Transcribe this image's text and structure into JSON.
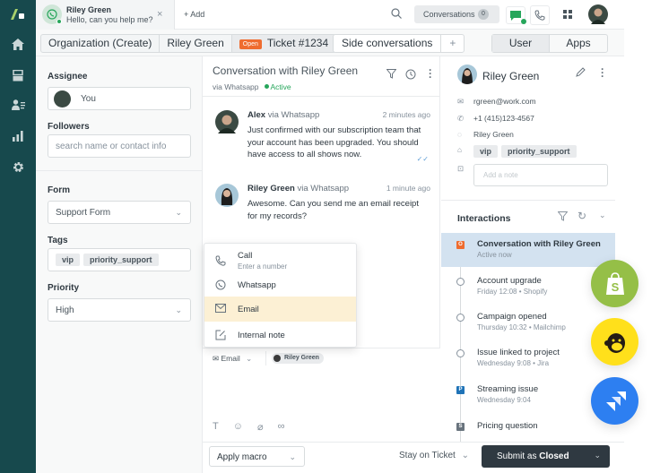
{
  "nav": {
    "items": [
      "home-icon",
      "tickets-icon",
      "customers-icon",
      "reporting-icon",
      "settings-icon"
    ]
  },
  "topbar": {
    "tab": {
      "name": "Riley Green",
      "message": "Hello, can you help me?",
      "close": "×",
      "channel_icon": "whatsapp-icon"
    },
    "add_label": "+ Add",
    "conversations_label": "Conversations",
    "conversations_count": "0"
  },
  "breadcrumbs": {
    "organization": "Organization (Create)",
    "user": "Riley Green",
    "status_badge": "Open",
    "ticket": "Ticket #1234",
    "side_conversations": "Side conversations",
    "add": "+",
    "user_tab": "User",
    "apps_tab": "Apps"
  },
  "left": {
    "assignee_label": "Assignee",
    "assignee_value": "You",
    "followers_label": "Followers",
    "followers_placeholder": "search name or contact info",
    "form_label": "Form",
    "form_value": "Support Form",
    "tags_label": "Tags",
    "tags": [
      "vip",
      "priority_support"
    ],
    "priority_label": "Priority",
    "priority_value": "High"
  },
  "conversation": {
    "title": "Conversation with Riley Green",
    "channel": "via Whatsapp",
    "status": "Active",
    "messages": [
      {
        "author": "Alex",
        "via": "via Whatsapp",
        "time": "2 minutes ago",
        "text": "Just confirmed with our subscription team that your account has been upgraded. You should have access to all shows now."
      },
      {
        "author": "Riley Green",
        "via": "via Whatsapp",
        "time": "1 minute ago",
        "text": "Awesome. Can you send me an email receipt for my records?"
      }
    ]
  },
  "channel_menu": {
    "items": [
      {
        "label": "Call",
        "sub": "Enter a number",
        "icon": "phone-icon"
      },
      {
        "label": "Whatsapp",
        "icon": "whatsapp-icon"
      },
      {
        "label": "Email",
        "icon": "email-icon",
        "selected": true
      },
      {
        "label": "Internal note",
        "icon": "note-icon"
      }
    ]
  },
  "composer": {
    "channel": "Email",
    "recipient": "Riley Green"
  },
  "footer": {
    "macro": "Apply macro",
    "stay": "Stay on Ticket",
    "submit_prefix": "Submit as ",
    "submit_status": "Closed"
  },
  "user_panel": {
    "name": "Riley Green",
    "email": "rgreen@work.com",
    "phone": "+1 (415)123-4567",
    "whatsapp": "Riley Green",
    "tags": [
      "vip",
      "priority_support"
    ],
    "note_placeholder": "Add a note"
  },
  "interactions": {
    "title": "Interactions",
    "items": [
      {
        "title": "Conversation with Riley Green",
        "sub": "Active now",
        "marker": "O",
        "color": "#ef6c2f",
        "active": true
      },
      {
        "title": "Account upgrade",
        "sub": "Friday 12:08 • Shopify",
        "marker": ""
      },
      {
        "title": "Campaign opened",
        "sub": "Thursday 10:32 • Mailchimp",
        "marker": ""
      },
      {
        "title": "Issue linked to project",
        "sub": "Wednesday 9:08 • Jira",
        "marker": ""
      },
      {
        "title": "Streaming issue",
        "sub": "Wednesday 9:04",
        "marker": "P",
        "color": "#1f73b7"
      },
      {
        "title": "Pricing question",
        "sub": "",
        "marker": "S",
        "color": "#68737d"
      }
    ]
  },
  "integrations": [
    "shopify-icon",
    "mailchimp-icon",
    "jira-icon"
  ],
  "colors": {
    "nav": "#17494d",
    "accent_green": "#26a65b",
    "open_badge": "#ef6c2f",
    "submit": "#2f3941"
  }
}
